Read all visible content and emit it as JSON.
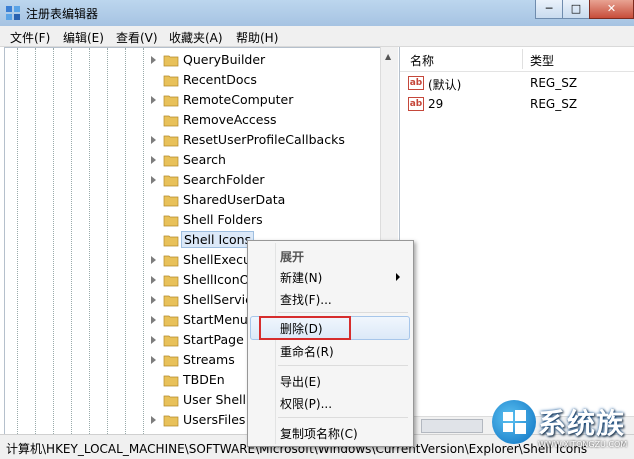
{
  "window": {
    "title": "注册表编辑器",
    "controls": {
      "minimize": "─",
      "maximize": "□",
      "close": "✕"
    }
  },
  "menubar": [
    "文件(F)",
    "编辑(E)",
    "查看(V)",
    "收藏夹(A)",
    "帮助(H)"
  ],
  "tree": {
    "items": [
      {
        "label": "QueryBuilder",
        "expandable": true
      },
      {
        "label": "RecentDocs",
        "expandable": false
      },
      {
        "label": "RemoteComputer",
        "expandable": true
      },
      {
        "label": "RemoveAccess",
        "expandable": false
      },
      {
        "label": "ResetUserProfileCallbacks",
        "expandable": true
      },
      {
        "label": "Search",
        "expandable": true
      },
      {
        "label": "SearchFolder",
        "expandable": true
      },
      {
        "label": "SharedUserData",
        "expandable": false
      },
      {
        "label": "Shell Folders",
        "expandable": false
      },
      {
        "label": "Shell Icons",
        "expandable": false,
        "selected": true
      },
      {
        "label": "ShellExecut",
        "expandable": true
      },
      {
        "label": "ShellIconO",
        "expandable": true
      },
      {
        "label": "ShellService",
        "expandable": true
      },
      {
        "label": "StartMenu",
        "expandable": true
      },
      {
        "label": "StartPage",
        "expandable": true
      },
      {
        "label": "Streams",
        "expandable": true
      },
      {
        "label": "TBDEn",
        "expandable": false
      },
      {
        "label": "User Shell",
        "expandable": false
      },
      {
        "label": "UsersFiles",
        "expandable": true
      }
    ]
  },
  "list": {
    "headers": {
      "name": "名称",
      "type": "类型"
    },
    "rows": [
      {
        "name": "(默认)",
        "type": "REG_SZ",
        "icon": "ab"
      },
      {
        "name": "29",
        "type": "REG_SZ",
        "icon": "ab"
      }
    ]
  },
  "statusbar": {
    "path": "计算机\\HKEY_LOCAL_MACHINE\\SOFTWARE\\Microsoft\\Windows\\CurrentVersion\\Explorer\\Shell Icons"
  },
  "context_menu": {
    "expand": "展开",
    "new": "新建(N)",
    "find": "查找(F)...",
    "delete": "删除(D)",
    "rename": "重命名(R)",
    "export": "导出(E)",
    "permissions": "权限(P)...",
    "copy_key_name": "复制项名称(C)"
  },
  "watermark": {
    "brand": "系统族",
    "url": "WWW.XITONGZU.COM"
  },
  "colors": {
    "highlight_box": "#d62d2d",
    "folder": "#e8c15a"
  }
}
